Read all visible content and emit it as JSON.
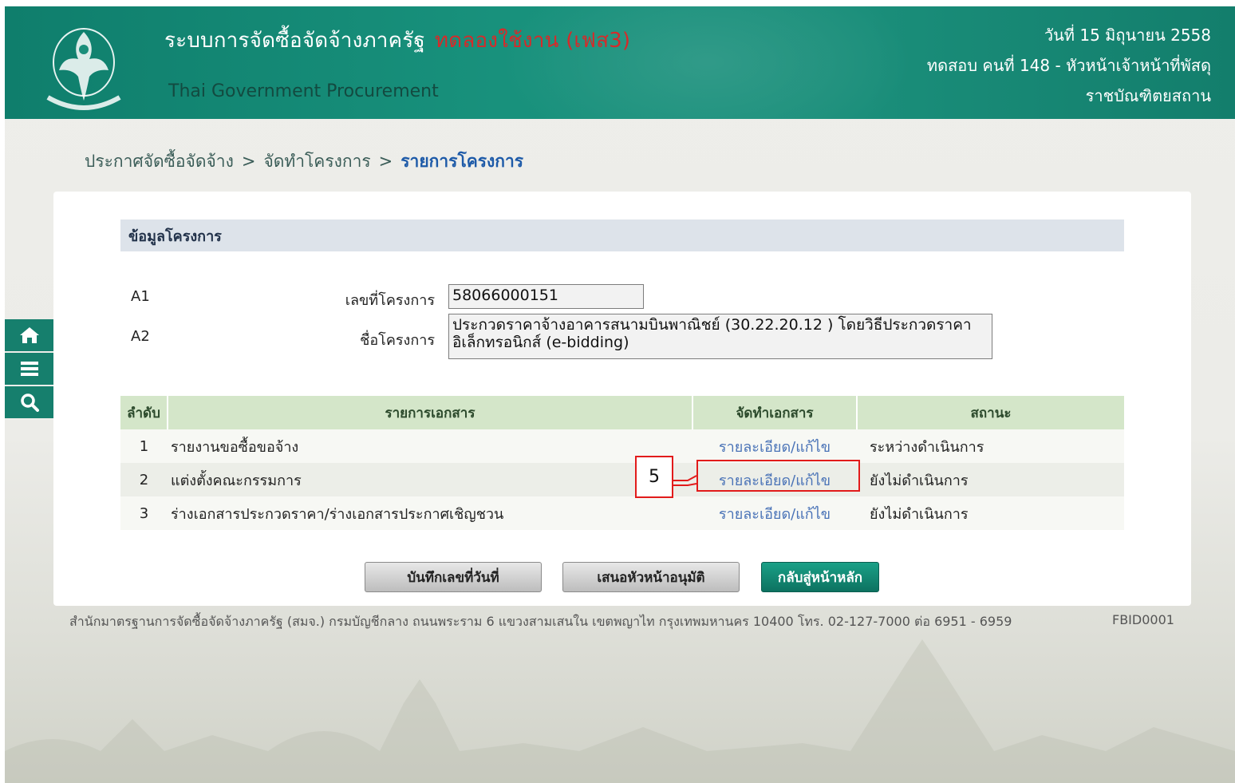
{
  "header": {
    "title": "ระบบการจัดซื้อจัดจ้างภาครัฐ",
    "title_suffix": "ทดลองใช้งาน (เฟส3)",
    "subtitle": "Thai Government Procurement",
    "date": "วันที่ 15 มิถุนายน 2558",
    "user": "ทดสอบ คนที่ 148 - หัวหน้าเจ้าหน้าที่พัสดุ",
    "org": "ราชบัณฑิตยสถาน"
  },
  "breadcrumb": {
    "items": [
      "ประกาศจัดซื้อจัดจ้าง",
      "จัดทำโครงการ",
      "รายการโครงการ"
    ],
    "separator": ">"
  },
  "side_tools": [
    "home-icon",
    "menu-icon",
    "search-icon"
  ],
  "project": {
    "section_title": "ข้อมูลโครงการ",
    "rows": [
      {
        "code": "A1",
        "label": "เลขที่โครงการ",
        "value": "58066000151"
      },
      {
        "code": "A2",
        "label": "ชื่อโครงการ",
        "value": "ประกวดราคาจ้างอาคารสนามบินพาณิชย์ (30.22.20.12 ) โดยวิธีประกวดราคาอิเล็กทรอนิกส์ (e-bidding)"
      }
    ]
  },
  "documents": {
    "headers": [
      "ลำดับ",
      "รายการเอกสาร",
      "จัดทำเอกสาร",
      "สถานะ"
    ],
    "rows": [
      {
        "no": "1",
        "doc": "รายงานขอซื้อขอจ้าง",
        "action": "รายละเอียด/แก้ไข",
        "status": "ระหว่างดำเนินการ"
      },
      {
        "no": "2",
        "doc": "แต่งตั้งคณะกรรมการ",
        "action": "รายละเอียด/แก้ไข",
        "status": "ยังไม่ดำเนินการ"
      },
      {
        "no": "3",
        "doc": "ร่างเอกสารประกวดราคา/ร่างเอกสารประกาศเชิญชวน",
        "action": "รายละเอียด/แก้ไข",
        "status": "ยังไม่ดำเนินการ"
      }
    ]
  },
  "annotation": {
    "label": "5"
  },
  "buttons": {
    "save": "บันทึกเลขที่วันที่",
    "propose": "เสนอหัวหน้าอนุมัติ",
    "back": "กลับสู่หน้าหลัก"
  },
  "footer": {
    "text": "สำนักมาตรฐานการจัดซื้อจัดจ้างภาครัฐ (สมจ.) กรมบัญชีกลาง ถนนพระราม 6 แขวงสามเสนใน เขตพญาไท กรุงเทพมหานคร 10400 โทร. 02-127-7000 ต่อ 6951 - 6959",
    "code": "FBID0001"
  },
  "colors": {
    "header": "#18917c",
    "annotation": "#e21b1b",
    "link": "#4a73b7",
    "table_header": "#d4e6c9"
  }
}
